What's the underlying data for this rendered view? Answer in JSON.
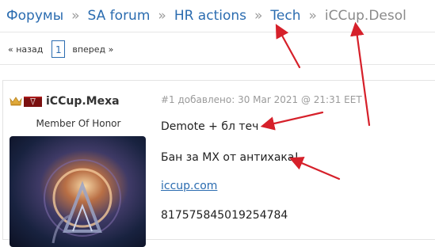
{
  "breadcrumb": {
    "items": [
      {
        "label": "Форумы"
      },
      {
        "label": "SA forum"
      },
      {
        "label": "HR actions"
      },
      {
        "label": "Tech"
      },
      {
        "label": "iCCup.Desol",
        "current": true
      }
    ],
    "separator": "»"
  },
  "pager": {
    "prev_label": "« назад",
    "current_page": "1",
    "next_label": "вперед »"
  },
  "post": {
    "username": "iCCup.Mexa",
    "rank": "Member Of Honor",
    "meta": "#1 добавлено: 30 Mar 2021 @ 21:31 EET",
    "lines": [
      "Demote + бл теч",
      "Бан за МХ от антихака!",
      "iccup.com",
      "817575845019254784"
    ]
  },
  "colors": {
    "link": "#2b6cb0",
    "annotation": "#d6202a",
    "muted": "#8a8a8a"
  },
  "icons": {
    "crown": "crown-icon",
    "flag": "clan-flag-icon"
  }
}
